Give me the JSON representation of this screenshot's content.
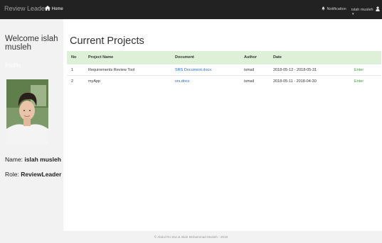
{
  "navbar": {
    "brand": "Review Leader",
    "home_label": "Home",
    "notification_label": "Notification",
    "user_label": "islah musleh"
  },
  "sidebar": {
    "welcome": "Welcome islah musleh",
    "profile_label": "Profile",
    "name_label": "Name:",
    "name_value": "islah musleh",
    "role_label": "Role:",
    "role_value": "ReviewLeader"
  },
  "main": {
    "title": "Current Projects",
    "columns": [
      "No",
      "Project Name",
      "Document",
      "Author",
      "Date",
      ""
    ],
    "rows": [
      {
        "no": "1",
        "name": "Requirements Review Tool",
        "document": "SRS Document.docx",
        "author": "ismail",
        "date": "2018-05-12 - 2018-05-31",
        "action": "Enter"
      },
      {
        "no": "2",
        "name": "myApp",
        "document": "srs.docx",
        "author": "ismail",
        "date": "2018-05-11 - 2018-04-30",
        "action": "Enter"
      }
    ]
  },
  "footer": {
    "text": "© Abdul Ro Zaz & Islah Mohammad Musleh - 2018"
  },
  "colors": {
    "navbar": "#222222",
    "header_row": "#dff0d8",
    "link": "#2a6ebb",
    "enter": "#3c9a3c"
  }
}
